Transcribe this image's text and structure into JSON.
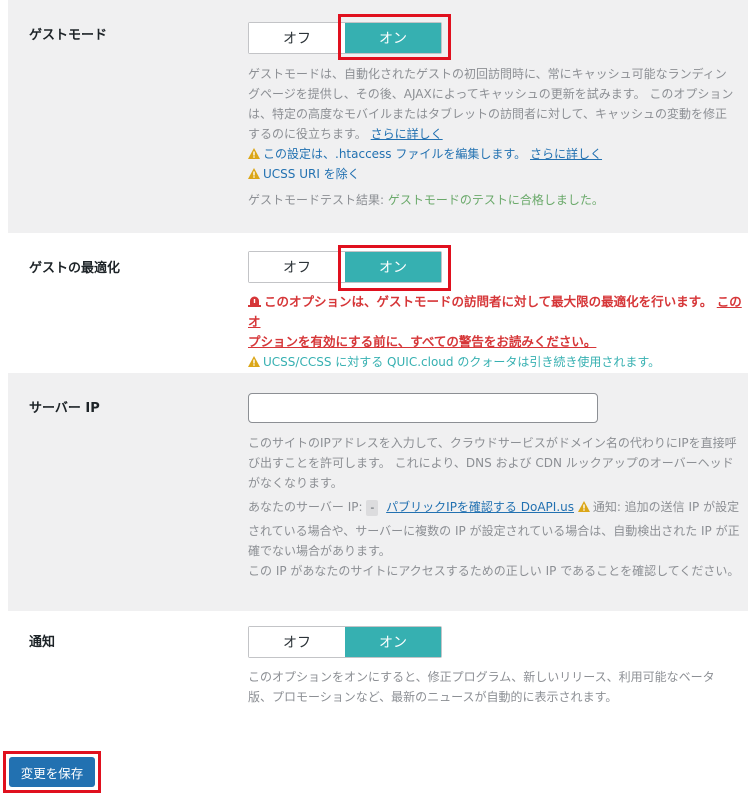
{
  "guest_mode": {
    "label": "ゲストモード",
    "off": "オフ",
    "on": "オン",
    "desc_line1": "ゲストモードは、自動化されたゲストの初回訪問時に、常にキャッシュ可能なランディン",
    "desc_line2": "グページを提供し、その後、AJAXによってキャッシュの更新を試みます。 このオプション",
    "desc_line3": "は、特定の高度なモバイルまたはタブレットの訪問者に対して、キャッシュの変動を修正",
    "desc_line4": "するのに役立ちます。",
    "learn_more": "さらに詳しく",
    "warn1": "この設定は、.htaccess ファイルを編集します。",
    "warn1_link": "さらに詳しく",
    "warn2": "UCSS URI を除く",
    "test_label": "ゲストモードテスト結果:",
    "test_result": "ゲストモードのテストに合格しました。"
  },
  "guest_opt": {
    "label": "ゲストの最適化",
    "off": "オフ",
    "on": "オン",
    "alert_line1": "このオプションは、ゲストモードの訪問者に対して最大限の最適化を行います。",
    "alert_link1": "このオ",
    "alert_link2": "プションを有効にする前に、すべての警告をお読みください。",
    "note": "UCSS/CCSS に対する QUIC.cloud のクォータは引き続き使用されます。"
  },
  "server_ip": {
    "label": "サーバー IP",
    "value": "",
    "desc_line1": "このサイトのIPアドレスを入力して、クラウドサービスがドメイン名の代わりにIPを直接呼",
    "desc_line2": "び出すことを許可します。 これにより、DNS および CDN ルックアップのオーバーヘッド",
    "desc_line3": "がなくなります。",
    "your_ip_label": "あなたのサーバー IP:",
    "your_ip_value": "-",
    "check_link": "パブリックIPを確認する DoAPI.us",
    "notice_label": "通知: 追加の送信 IP が設定",
    "notice_line2": "されている場合や、サーバーに複数の IP が設定されている場合は、自動検出された IP が正",
    "notice_line3": "確でない場合があります。",
    "notice_line4": "この IP があなたのサイトにアクセスするための正しい IP であることを確認してください。"
  },
  "notify": {
    "label": "通知",
    "off": "オフ",
    "on": "オン",
    "desc_line1": "このオプションをオンにすると、修正プログラム、新しいリリース、利用可能なベータ",
    "desc_line2": "版、プロモーションなど、最新のニュースが自動的に表示されます。"
  },
  "save_label": "変更を保存"
}
